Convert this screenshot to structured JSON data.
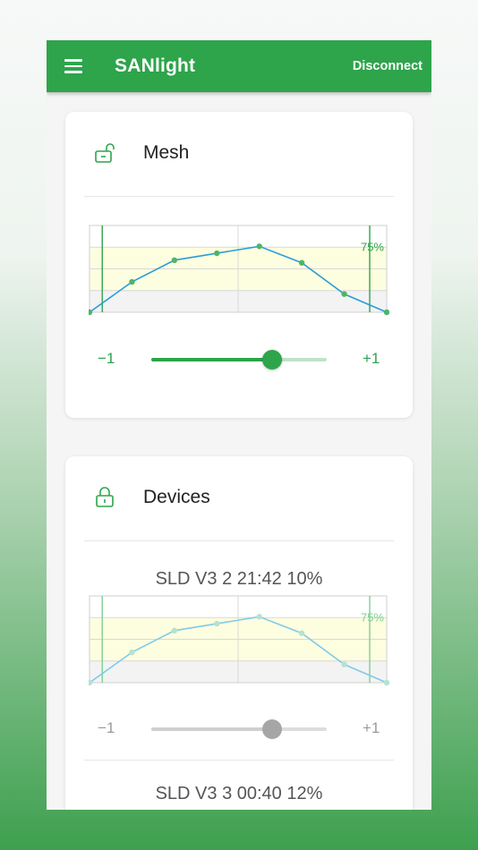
{
  "app": {
    "title": "SANlight",
    "disconnect_label": "Disconnect"
  },
  "colors": {
    "primary": "#2ea44b",
    "mesh_line": "#2a9ed8",
    "device_line": "#7fcbe8"
  },
  "mesh": {
    "title": "Mesh",
    "icon": "unlocked-padlock-icon",
    "chart_data": {
      "type": "line",
      "y_marker_label": "75%",
      "values": [
        0,
        35,
        60,
        68,
        76,
        57,
        21,
        0
      ],
      "ylim": [
        0,
        100
      ],
      "band": [
        25,
        75
      ]
    },
    "slider": {
      "min_label": "−1",
      "max_label": "+1",
      "value": 0.69
    }
  },
  "devices": {
    "title": "Devices",
    "icon": "locked-padlock-icon",
    "items": [
      {
        "name": "SLD V3 2 21:42 10%",
        "chart_data": {
          "type": "line",
          "y_marker_label": "75%",
          "values": [
            0,
            35,
            60,
            68,
            76,
            57,
            21,
            0
          ],
          "ylim": [
            0,
            100
          ],
          "band": [
            25,
            75
          ]
        },
        "slider": {
          "min_label": "−1",
          "max_label": "+1",
          "value": 0.69
        }
      },
      {
        "name": "SLD V3 3 00:40 12%"
      }
    ]
  }
}
